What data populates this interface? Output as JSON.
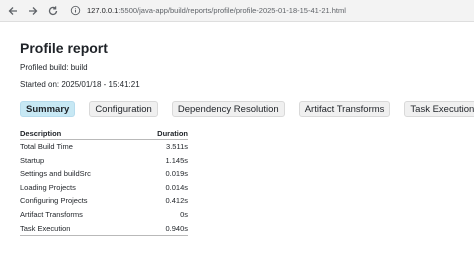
{
  "browser": {
    "address_host": "127.0.0.1",
    "address_rest": ":5500/java-app/build/reports/profile/profile-2025-01-18-15-41-21.html"
  },
  "report": {
    "title": "Profile report",
    "profiled_build": "Profiled build: build",
    "started_on": "Started on: 2025/01/18 - 15:41:21"
  },
  "tabs": [
    {
      "label": "Summary",
      "active": true
    },
    {
      "label": "Configuration",
      "active": false
    },
    {
      "label": "Dependency Resolution",
      "active": false
    },
    {
      "label": "Artifact Transforms",
      "active": false
    },
    {
      "label": "Task Execution",
      "active": false
    }
  ],
  "table": {
    "headers": {
      "description": "Description",
      "duration": "Duration"
    },
    "rows": [
      {
        "description": "Total Build Time",
        "duration": "3.511s"
      },
      {
        "description": "Startup",
        "duration": "1.145s"
      },
      {
        "description": "Settings and buildSrc",
        "duration": "0.019s"
      },
      {
        "description": "Loading Projects",
        "duration": "0.014s"
      },
      {
        "description": "Configuring Projects",
        "duration": "0.412s"
      },
      {
        "description": "Artifact Transforms",
        "duration": "0s"
      },
      {
        "description": "Task Execution",
        "duration": "0.940s"
      }
    ]
  }
}
